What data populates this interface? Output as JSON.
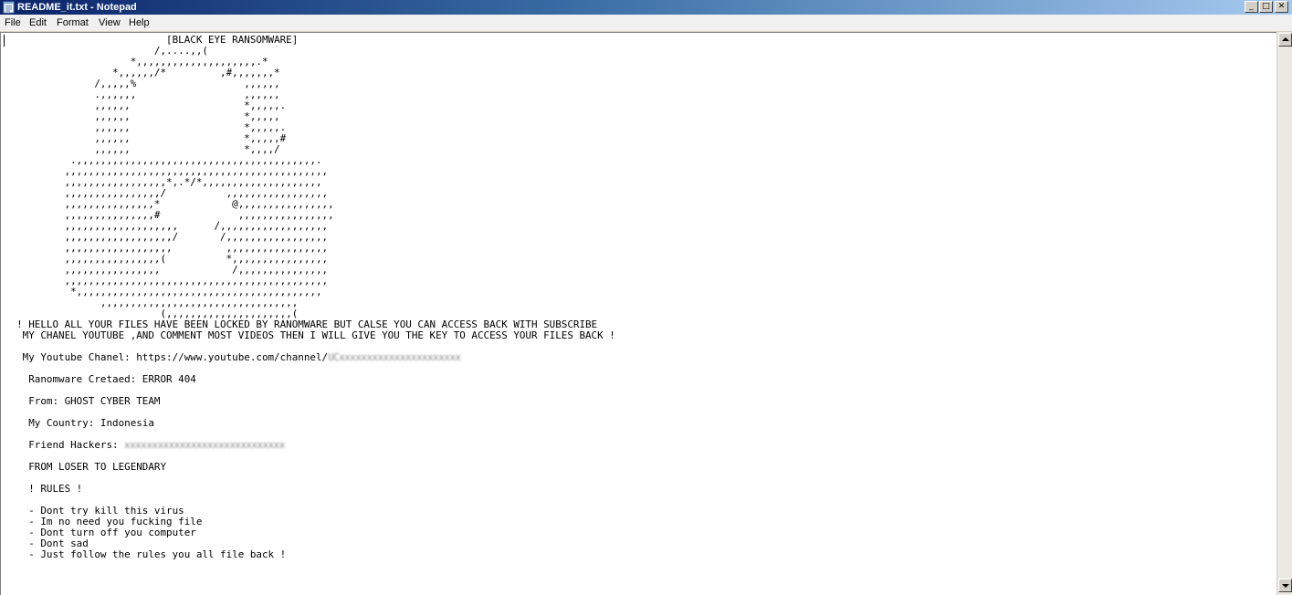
{
  "window": {
    "title": "README_it.txt - Notepad",
    "title_gradient_start": "#0b246a",
    "title_gradient_end": "#a6caf0",
    "controls": {
      "minimize": "_",
      "maximize": "□",
      "close": "✕"
    }
  },
  "menu": {
    "file": "File",
    "edit": "Edit",
    "format": "Format",
    "view": "View",
    "help": "Help"
  },
  "document": {
    "header": "[BLACK EYE RANSOMWARE]",
    "art_lines": [
      "                         /,....,,(",
      "                     *,,,,,,,,,,,,,,,,,,,,.*",
      "                  *,,,,,,/*         ,#,,,,,,,*",
      "               /,,,,,%                  ,,,,,,",
      "               .,,,,,,                  ,,,,,,",
      "               ,,,,,,                   *,,,,,.",
      "               ,,,,,,                   *,,,,,",
      "               ,,,,,,                   *,,,,,.",
      "               ,,,,,,                   *,,,,,#",
      "               ,,,,,,                   *,,,,/",
      "           .,,,,,,,,,,,,,,,,,,,,,,,,,,,,,,,,,,,,,,,,.",
      "          ,,,,,,,,,,,,,,,,,,,,,,,,,,,,,,,,,,,,,,,,,,,,",
      "          ,,,,,,,,,,,,,,,,,*,.*/*,,,,,,,,,,,,,,,,,,,,",
      "          ,,,,,,,,,,,,,,,,/          ,,,,,,,,,,,,,,,,,",
      "          ,,,,,,,,,,,,,,,*            @,,,,,,,,,,,,,,,,",
      "          ,,,,,,,,,,,,,,,#             ,,,,,,,,,,,,,,,,",
      "          ,,,,,,,,,,,,,,,,,,,      /,,,,,,,,,,,,,,,,,,",
      "          ,,,,,,,,,,,,,,,,,,/       /,,,,,,,,,,,,,,,,,",
      "          ,,,,,,,,,,,,,,,,,,         ,,,,,,,,,,,,,,,,,",
      "          ,,,,,,,,,,,,,,,,(          *,,,,,,,,,,,,,,,,",
      "          ,,,,,,,,,,,,,,,,            /,,,,,,,,,,,,,,,",
      "          ,,,,,,,,,,,,,,,,,,,,,,,,,,,,,,,,,,,,,,,,,,,,",
      "           *,,,,,,,,,,,,,,,,,,,,,,,,,,,,,,,,,,,,,,,,,",
      "                ,,,,,,,,,,,,,,,,,,,,,,,,,,,,,,,,,",
      "                          (,,,,,,,,,,,,,,,,,,,,,("
    ],
    "message_line_1": "  ! HELLO ALL YOUR FILES HAVE BEEN LOCKED BY RANOMWARE BUT CALSE YOU CAN ACCESS BACK WITH SUBSCRIBE",
    "message_line_2": "   MY CHANEL YOUTUBE ,AND COMMENT MOST VIDEOS THEN I WILL GIVE YOU THE KEY TO ACCESS YOUR FILES BACK !",
    "youtube_label": "   My Youtube Chanel: https://www.youtube.com/channel/",
    "youtube_redacted": "UCxxxxxxxxxxxxxxxxxxxxxx",
    "creator_line": "    Ranomware Cretaed: ERROR 404",
    "from_line": "    From: GHOST CYBER TEAM",
    "country_line": "    My Country: Indonesia",
    "friends_label": "    Friend Hackers: ",
    "friends_redacted": "xxxxxxxxxxxxxxxxxxxxxxxxxxxxx",
    "motto_line": "    FROM LOSER TO LEGENDARY",
    "rules_header": "    ! RULES !",
    "rules": [
      "    - Dont try kill this virus",
      "    - Im no need you fucking file",
      "    - Dont turn off you computer",
      "    - Dont sad",
      "    - Just follow the rules you all file back !"
    ]
  }
}
